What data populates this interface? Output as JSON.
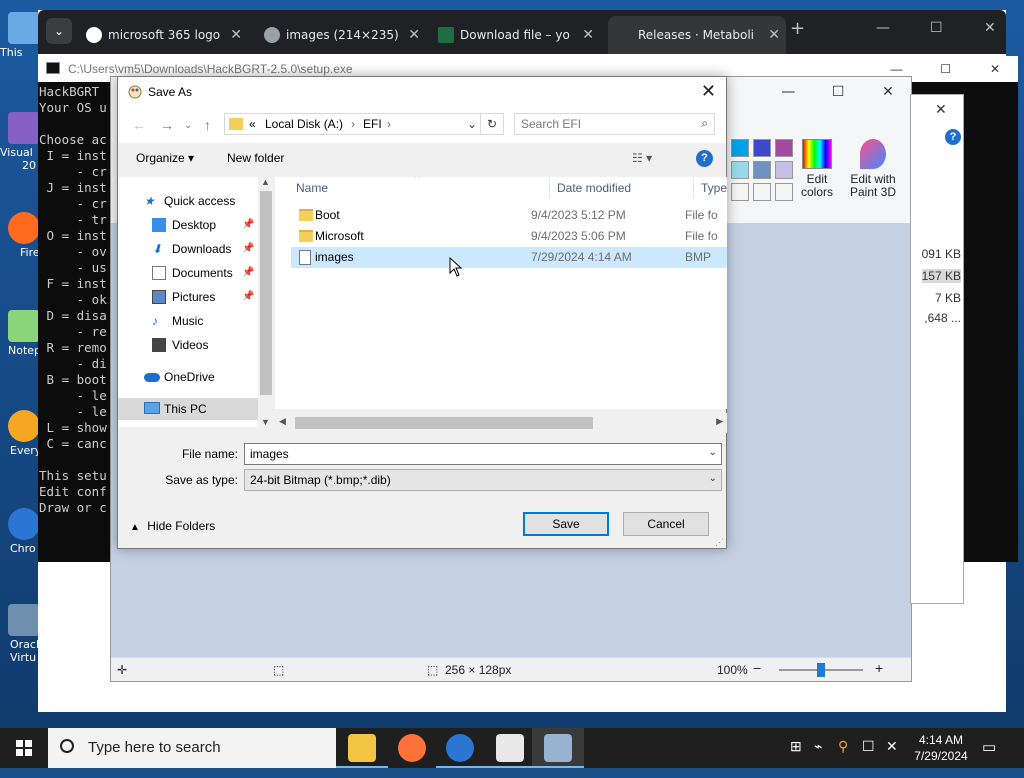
{
  "desktop_icons": [
    {
      "label": "This"
    },
    {
      "label": "Visual"
    },
    {
      "label": "20"
    },
    {
      "label": "Fire"
    },
    {
      "label": "Notep"
    },
    {
      "label": "Every"
    },
    {
      "label": "Chro"
    },
    {
      "label": "Oracl"
    },
    {
      "label": "Virtu"
    }
  ],
  "browser": {
    "tabs": [
      {
        "title": "microsoft 365 logo",
        "close": "✕"
      },
      {
        "title": "images (214×235)",
        "close": "✕"
      },
      {
        "title": "Download file – yo",
        "close": "✕"
      },
      {
        "title": "Releases · Metaboli",
        "close": "✕"
      }
    ],
    "new_tab": "+",
    "minimize": "—",
    "maximize": "☐",
    "close": "✕"
  },
  "console": {
    "title": "C:\\Users\\vm5\\Downloads\\HackBGRT-2.5.0\\setup.exe",
    "lines": [
      "HackBGRT",
      "Your OS u",
      "",
      "Choose ac",
      " I = inst",
      "     - cr",
      " J = inst",
      "     - cr",
      "     - tr",
      " O = inst",
      "     - ov",
      "     - us",
      " F = inst",
      "     - ok",
      " D = disa",
      "     - re",
      " R = remo",
      "     - di",
      " B = boot",
      "     - le",
      "     - le",
      " L = show",
      " C = canc",
      "",
      "This setu",
      "Edit conf",
      "Draw or c"
    ]
  },
  "paint": {
    "edit_colors": "Edit\ncolors",
    "edit_paint3d": "Edit with\nPaint 3D",
    "status": {
      "size": "256 × 128px",
      "zoom": "100%",
      "zoom_minus": "−",
      "zoom_plus": "+"
    }
  },
  "explorer_side": {
    "sizes": [
      "091 KB",
      "157 KB",
      "7 KB",
      ",648 ..."
    ],
    "help": "?"
  },
  "dialog": {
    "title": "Save As",
    "close": "✕",
    "address": {
      "prefix": "«",
      "segments": [
        "Local Disk (A:)",
        "EFI"
      ],
      "sep": "›"
    },
    "search_placeholder": "Search EFI",
    "toolbar": {
      "organize": "Organize ▾",
      "new_folder": "New folder",
      "view": "☷ ▾",
      "help": "?"
    },
    "nav": [
      {
        "label": "Quick access",
        "pinned": false
      },
      {
        "label": "Desktop",
        "pinned": true
      },
      {
        "label": "Downloads",
        "pinned": true
      },
      {
        "label": "Documents",
        "pinned": true
      },
      {
        "label": "Pictures",
        "pinned": true
      },
      {
        "label": "Music",
        "pinned": false
      },
      {
        "label": "Videos",
        "pinned": false
      },
      {
        "label": "OneDrive",
        "pinned": false
      },
      {
        "label": "This PC",
        "pinned": false
      }
    ],
    "columns": {
      "name": "Name",
      "date": "Date modified",
      "type": "Type"
    },
    "files": [
      {
        "name": "Boot",
        "date": "9/4/2023 5:12 PM",
        "type": "File fo",
        "kind": "folder"
      },
      {
        "name": "Microsoft",
        "date": "9/4/2023 5:06 PM",
        "type": "File fo",
        "kind": "folder"
      },
      {
        "name": "images",
        "date": "7/29/2024 4:14 AM",
        "type": "BMP",
        "kind": "bmp"
      }
    ],
    "file_name_label": "File name:",
    "file_name_value": "images",
    "save_type_label": "Save as type:",
    "save_type_value": "24-bit Bitmap (*.bmp;*.dib)",
    "hide_folders": "Hide Folders",
    "save": "Save",
    "cancel": "Cancel"
  },
  "taskbar": {
    "search_placeholder": "Type here to search",
    "time": "4:14 AM",
    "date": "7/29/2024"
  }
}
